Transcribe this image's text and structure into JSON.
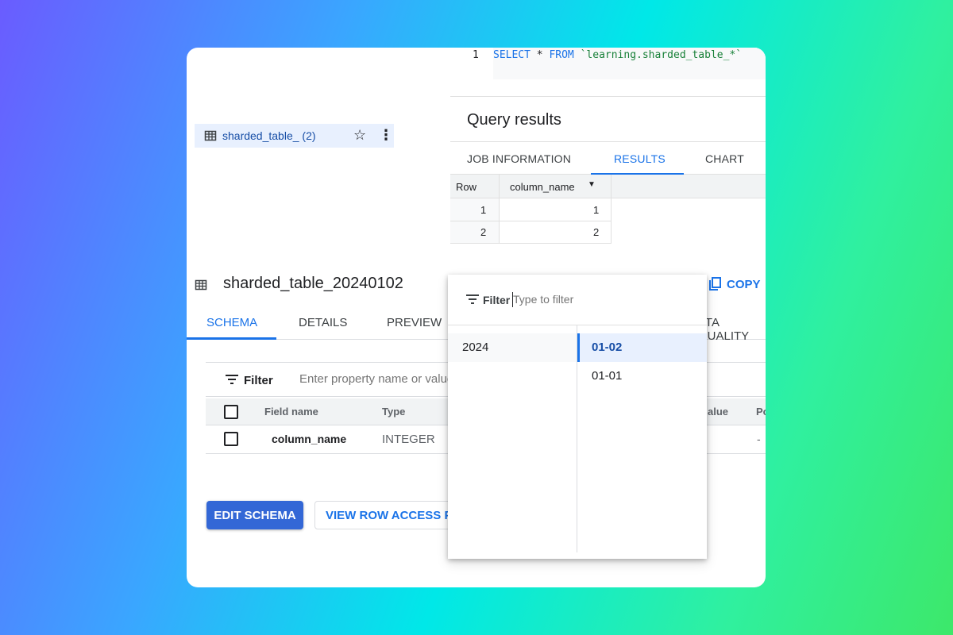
{
  "editor": {
    "line_number": "1",
    "sql_keyword_select": "SELECT",
    "sql_star": " * ",
    "sql_keyword_from": "FROM",
    "sql_table": " `learning.sharded_table_*`"
  },
  "explorer": {
    "item_label": "sharded_table_ (2)"
  },
  "query_results": {
    "title": "Query results",
    "tabs": [
      "JOB INFORMATION",
      "RESULTS",
      "CHART"
    ],
    "columns": [
      "Row",
      "column_name"
    ],
    "rows": [
      {
        "row": "1",
        "value": "1"
      },
      {
        "row": "2",
        "value": "2"
      }
    ]
  },
  "table_detail": {
    "title": "sharded_table_20240102",
    "copy_label": "COPY",
    "tabs": [
      "SCHEMA",
      "DETAILS",
      "PREVIEW",
      "ATA QUALITY"
    ],
    "filter_label": "Filter",
    "filter_placeholder": "Enter property name or value",
    "columns": [
      "Field name",
      "Type",
      "alue",
      "Po"
    ],
    "rows": [
      {
        "field": "column_name",
        "type": "INTEGER",
        "extra": "-"
      }
    ],
    "edit_schema_label": "EDIT SCHEMA",
    "view_row_access_label": "VIEW ROW ACCESS PO"
  },
  "shard_picker": {
    "filter_label": "Filter",
    "filter_placeholder": "Type to filter",
    "years": [
      "2024"
    ],
    "dates": [
      "01-02",
      "01-01"
    ],
    "selected_date": "01-02"
  },
  "colors": {
    "accent": "#1a73e8",
    "primary_button": "#3367d6",
    "selected_bg": "#e8f0fe"
  }
}
